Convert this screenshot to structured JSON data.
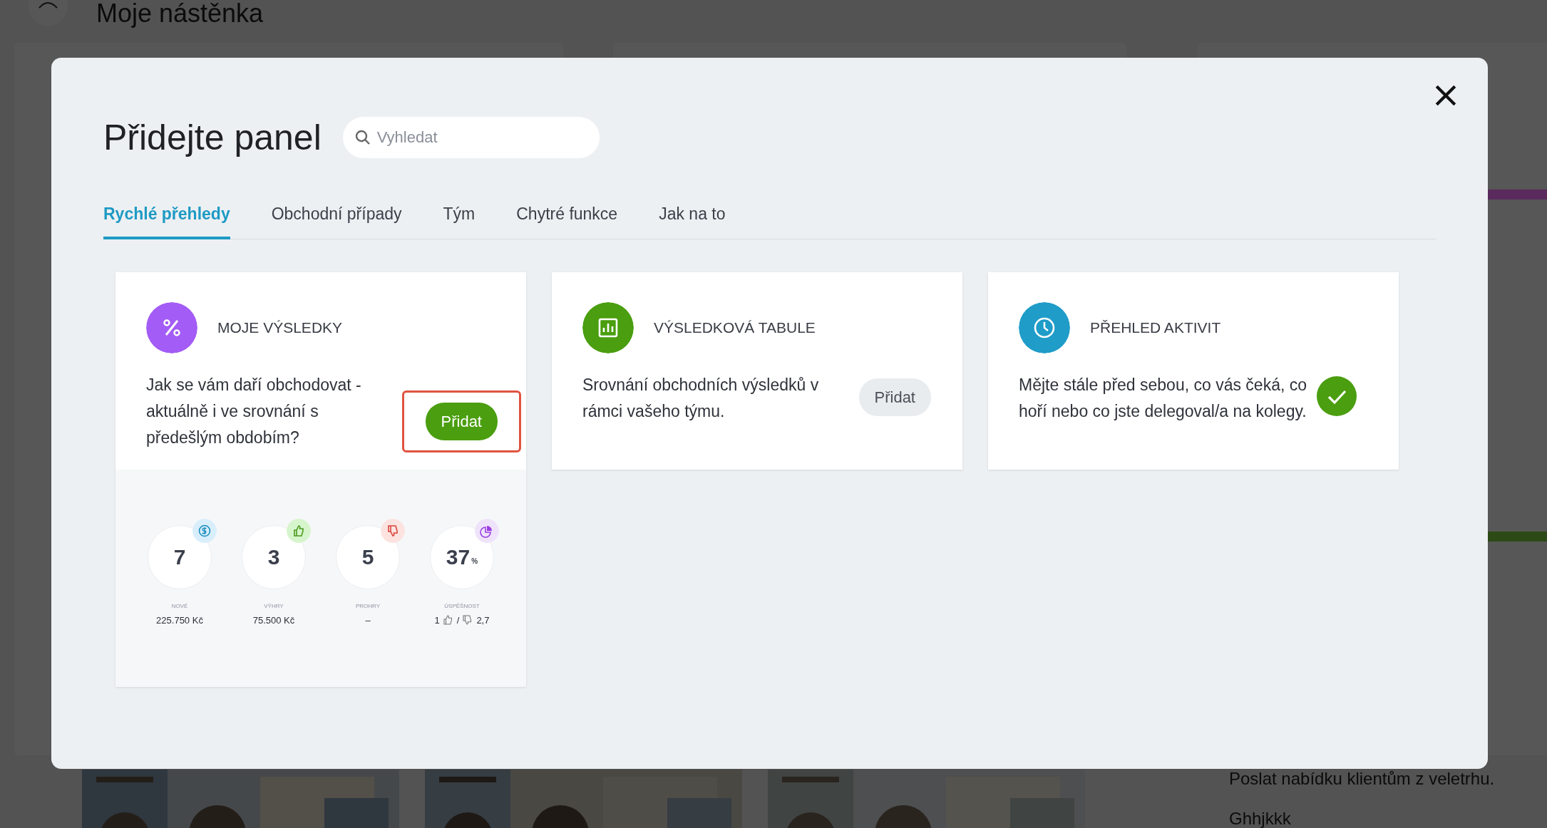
{
  "background": {
    "page_title": "Moje nástěnka",
    "stripes": [
      {
        "color": "#5a2a5c"
      },
      {
        "color": "#2c4a16"
      }
    ],
    "pictures": [
      {
        "kind": "picture"
      },
      {
        "kind": "picture"
      },
      {
        "kind": "picture"
      }
    ],
    "task_items": [
      "Poslat nabídku klientům z veletrhu.",
      "Ghhjkkk"
    ]
  },
  "modal": {
    "title": "Přidejte panel",
    "search": {
      "placeholder": "Vyhledat"
    },
    "tabs": [
      {
        "label": "Rychlé přehledy",
        "selected": true
      },
      {
        "label": "Obchodní případy",
        "selected": false
      },
      {
        "label": "Tým",
        "selected": false
      },
      {
        "label": "Chytré funkce",
        "selected": false
      },
      {
        "label": "Jak na to",
        "selected": false
      }
    ],
    "cards": [
      {
        "title": "MOJE VÝSLEDKY",
        "color": "#a35cf5",
        "description": "Jak se vám daří obchodovat - aktuálně i ve srovnání s předešlým obdobím?",
        "added": false,
        "action": {
          "label": "Přidat",
          "kind": "primary",
          "highlighted": true
        },
        "preview": {
          "stats": [
            {
              "kind": "amount",
              "value": "7",
              "label": "NOVÉ",
              "detail": "225.750 Kč",
              "color": "#d9eefb"
            },
            {
              "kind": "amount",
              "value": "3",
              "label": "VÝHRY",
              "detail": "75.500 Kč",
              "color": "#d6f5cc"
            },
            {
              "kind": "amount",
              "value": "5",
              "label": "PROHRY",
              "detail": "–",
              "color": "#fde3e0"
            },
            {
              "kind": "ratio",
              "value": "37",
              "unit": "%",
              "label": "ÚSPĚŠNOST",
              "wins": "1",
              "separator": "/",
              "losses": "2,7",
              "color": "#efe3fb"
            }
          ]
        }
      },
      {
        "title": "VÝSLEDKOVÁ TABULE",
        "color": "#4a9e0f",
        "description": "Srovnání obchodních výsledků v rámci vašeho týmu.",
        "added": false,
        "action": {
          "label": "Přidat",
          "kind": "secondary",
          "highlighted": false
        }
      },
      {
        "title": "PŘEHLED AKTIVIT",
        "color": "#1f9cc8",
        "description": "Mějte stále před sebou, co vás čeká, co hoří nebo co jste delegoval/a na kolegy.",
        "added": true
      }
    ]
  }
}
